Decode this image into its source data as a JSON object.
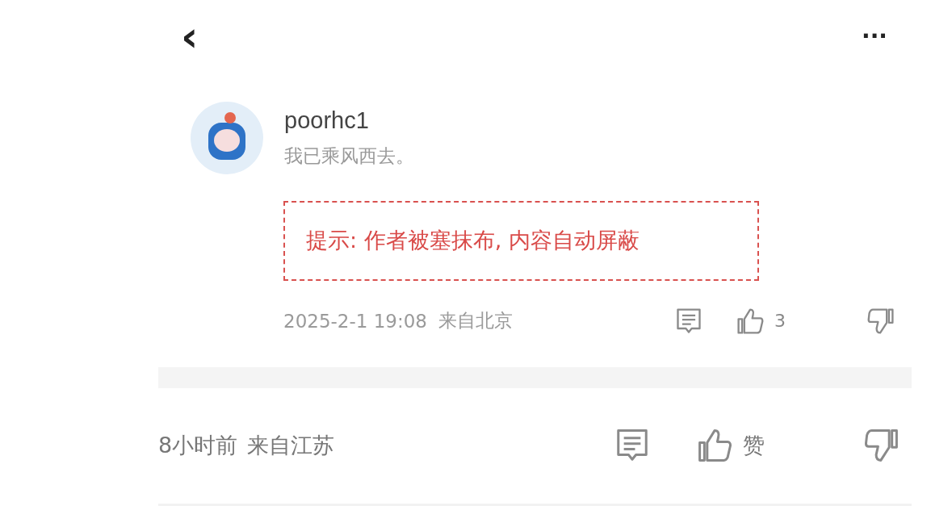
{
  "top_bar": {
    "back": "‹",
    "more": "···"
  },
  "quoted_comment": {
    "username": "poorhc1",
    "signature": "我已乘风西去。",
    "notice": "提示: 作者被塞抹布, 内容自动屏蔽",
    "time": "2025-2-1 19:08",
    "location": "来自北京",
    "like_count": "3"
  },
  "comment_footer": {
    "time": "8小时前",
    "location": "来自江苏",
    "like_label": "赞"
  }
}
